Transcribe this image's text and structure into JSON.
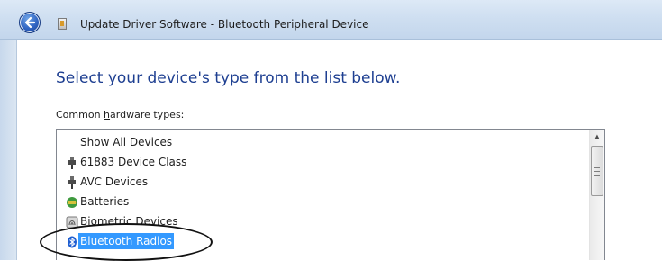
{
  "window": {
    "title": "Update Driver Software - Bluetooth Peripheral Device"
  },
  "page": {
    "heading": "Select your device's type from the list below.",
    "list_label_prefix": "Common ",
    "list_label_underlined": "h",
    "list_label_suffix": "ardware types:"
  },
  "hardware_list": {
    "items": [
      {
        "label": "Show All Devices",
        "icon": "none"
      },
      {
        "label": "61883 Device Class",
        "icon": "plug-icon"
      },
      {
        "label": "AVC Devices",
        "icon": "plug-icon"
      },
      {
        "label": "Batteries",
        "icon": "battery-icon"
      },
      {
        "label": "Biometric Devices",
        "icon": "fingerprint-icon"
      },
      {
        "label": "Bluetooth Radios",
        "icon": "bluetooth-icon",
        "selected": true
      }
    ]
  },
  "colors": {
    "heading": "#1e3f91",
    "selection": "#3399ff",
    "titlebar": "#cfdff1"
  }
}
